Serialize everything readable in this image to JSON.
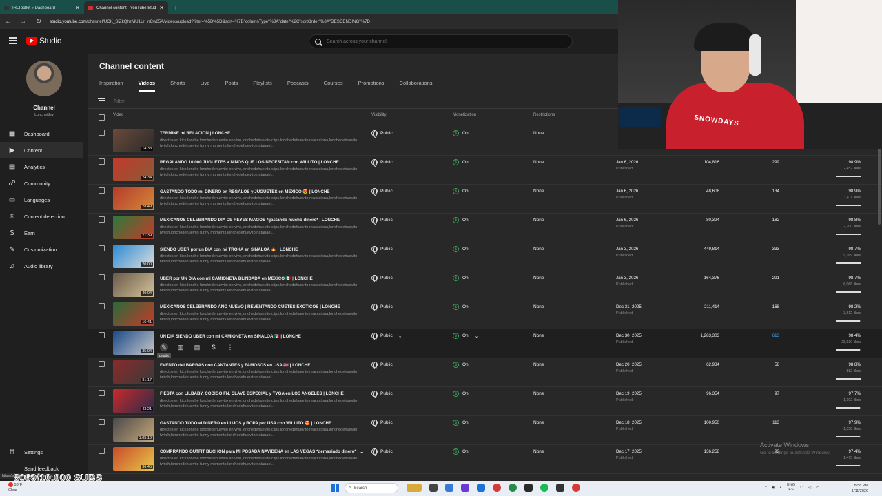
{
  "browser": {
    "tabs": [
      {
        "label": "IRLToolkit » Dashboard",
        "active": false
      },
      {
        "label": "Channel content - YouTube Studio",
        "active": true
      }
    ],
    "url_host": "studio.youtube.com",
    "url_path": "/channel/UCK_SlZkQhzMU1LrHnCw85A/videos/upload?filter=%5B%5D&sort=%7B\"columnType\"%3A\"date\"%2C\"sortOrder\"%3A\"DESCENDING\"%7D"
  },
  "header": {
    "logo_text": "Studio",
    "search_placeholder": "Search across your channel"
  },
  "sidebar": {
    "channel_label": "Channel",
    "channel_handle": "Loncheitley",
    "items": [
      {
        "label": "Dashboard",
        "icon": "dashboard-icon",
        "glyph": "▦"
      },
      {
        "label": "Content",
        "icon": "content-icon",
        "glyph": "▶",
        "active": true
      },
      {
        "label": "Analytics",
        "icon": "analytics-icon",
        "glyph": "▤"
      },
      {
        "label": "Community",
        "icon": "community-icon",
        "glyph": "☍"
      },
      {
        "label": "Languages",
        "icon": "languages-icon",
        "glyph": "▭"
      },
      {
        "label": "Content detection",
        "icon": "copyright-icon",
        "glyph": "©"
      },
      {
        "label": "Earn",
        "icon": "earn-icon",
        "glyph": "$"
      },
      {
        "label": "Customization",
        "icon": "customization-icon",
        "glyph": "✎"
      },
      {
        "label": "Audio library",
        "icon": "audio-library-icon",
        "glyph": "♫"
      }
    ],
    "settings_label": "Settings",
    "feedback_label": "Send feedback"
  },
  "main": {
    "title": "Channel content",
    "tabs": [
      "Inspiration",
      "Videos",
      "Shorts",
      "Live",
      "Posts",
      "Playlists",
      "Podcasts",
      "Courses",
      "Promotions",
      "Collaborations"
    ],
    "active_tab": "Videos",
    "filter_placeholder": "Filter",
    "columns": {
      "video": "Video",
      "visibility": "Visibility",
      "monetization": "Monetization",
      "restrictions": "Restrictions"
    }
  },
  "rows": [
    {
      "title": "TERMINE mi RELACION | LONCHE",
      "desc": "directos en kick:lonche lonchedehuevito en vivo,lonchedehuevito clips,lonchedehuevito reaccciona,lonchedehuevito twitch,lonchedehuevito funny moments,lonchedehuevito natanael...",
      "duration": "14:38",
      "visibility": "Public",
      "monetization": "On",
      "restrictions": "None",
      "date": "",
      "date_sub": "",
      "views": "",
      "comments": "",
      "pct": "",
      "likes": "",
      "ratio": 0,
      "thumb": [
        "#6a4a3a",
        "#2a2a2a"
      ]
    },
    {
      "title": "REGALANDO 10.000 JUGUETES a NIÑOS QUE LOS NECESITAN con WILLITO | LONCHE",
      "desc": "directos en kick:lonche lonchedehuevito en vivo,lonchedehuevito clips,lonchedehuevito reaccciona,lonchedehuevito twitch,lonchedehuevito funny moments,lonchedehuevito natanael...",
      "duration": "24:34",
      "visibility": "Public",
      "monetization": "On",
      "restrictions": "None",
      "date": "Jan 6, 2026",
      "date_sub": "Published",
      "views": "104,816",
      "comments": "299",
      "pct": "98.9%",
      "likes": "2,452 likes",
      "ratio": 0.989,
      "thumb": [
        "#c23a2a",
        "#8a5a3a"
      ]
    },
    {
      "title": "GASTANDO TODO mi DINERO en REGALOS y JUGUETES en MEXICO 😍 | LONCHE",
      "desc": "directos en kick:lonche lonchedehuevito en vivo,lonchedehuevito clips,lonchedehuevito reaccciona,lonchedehuevito twitch,lonchedehuevito funny moments,lonchedehuevito natanael...",
      "duration": "28:49",
      "visibility": "Public",
      "monetization": "On",
      "restrictions": "None",
      "date": "Jan 6, 2026",
      "date_sub": "Published",
      "views": "48,608",
      "comments": "134",
      "pct": "98.9%",
      "likes": "1,411 likes",
      "ratio": 0.989,
      "thumb": [
        "#b53a2a",
        "#d48a3a"
      ]
    },
    {
      "title": "MEXICANOS CELEBRANDO DIA DE REYES MAGOS *gastando mucho dinero* | LONCHE",
      "desc": "directos en kick:lonche lonchedehuevito en vivo,lonchedehuevito clips,lonchedehuevito reaccciona,lonchedehuevito twitch,lonchedehuevito funny moments,lonchedehuevito natanael...",
      "duration": "21:39",
      "visibility": "Public",
      "monetization": "On",
      "restrictions": "None",
      "date": "Jan 6, 2026",
      "date_sub": "Published",
      "views": "80,324",
      "comments": "182",
      "pct": "98.8%",
      "likes": "2,200 likes",
      "ratio": 0.988,
      "thumb": [
        "#2a7a3a",
        "#c83a2a"
      ]
    },
    {
      "title": "SIENDO UBER por un DIA con mi TROKA en SINALOA 🔥 | LONCHE",
      "desc": "directos en kick:lonche lonchedehuevito en vivo,lonchedehuevito clips,lonchedehuevito reaccciona,lonchedehuevito twitch,lonchedehuevito funny moments,lonchedehuevito natanael...",
      "duration": "20:00",
      "visibility": "Public",
      "monetization": "On",
      "restrictions": "None",
      "date": "Jan 3, 2026",
      "date_sub": "Published",
      "views": "449,814",
      "comments": "333",
      "pct": "98.7%",
      "likes": "9,169 likes",
      "ratio": 0.987,
      "thumb": [
        "#2a8ad4",
        "#ddd"
      ]
    },
    {
      "title": "UBER por UN DÍA con mi CAMIONETA BLINDADA en MEXICO 🇲🇽 | LONCHE",
      "desc": "directos en kick:lonche lonchedehuevito en vivo,lonchedehuevito clips,lonchedehuevito reaccciona,lonchedehuevito twitch,lonchedehuevito funny moments,lonchedehuevito natanael...",
      "duration": "40:04",
      "visibility": "Public",
      "monetization": "On",
      "restrictions": "None",
      "date": "Jan 3, 2026",
      "date_sub": "Published",
      "views": "164,376",
      "comments": "291",
      "pct": "98.7%",
      "likes": "6,068 likes",
      "ratio": 0.987,
      "thumb": [
        "#6a5a4a",
        "#d4c49a"
      ]
    },
    {
      "title": "MEXICANOS CELEBRANDO AÑO NUEVO | REVENTANDO CUETES EXOTICOS | LONCHE",
      "desc": "directos en kick:lonche lonchedehuevito en vivo,lonchedehuevito clips,lonchedehuevito reaccciona,lonchedehuevito twitch,lonchedehuevito funny moments,lonchedehuevito natanael...",
      "duration": "16:41",
      "visibility": "Public",
      "monetization": "On",
      "restrictions": "None",
      "date": "Dec 31, 2025",
      "date_sub": "Published",
      "views": "211,414",
      "comments": "168",
      "pct": "98.2%",
      "likes": "3,612 likes",
      "ratio": 0.982,
      "thumb": [
        "#2a6a3a",
        "#c83a2a"
      ]
    },
    {
      "title": "UN DIA SIENDO UBER con mi CAMIONETA en SINALOA 🇲🇽 | LONCHE",
      "desc": "",
      "duration": "35:04",
      "visibility": "Public",
      "monetization": "On",
      "restrictions": "None",
      "date": "Dec 30, 2025",
      "date_sub": "Published",
      "views": "1,283,303",
      "comments": "613",
      "pct": "98.4%",
      "likes": "25,930 likes",
      "ratio": 0.984,
      "thumb": [
        "#1a4a8a",
        "#c8c8c8"
      ],
      "hover": true
    },
    {
      "title": "EVENTO del BARBAS con CANTANTES y FAMOSOS en USA 🇺🇸 | LONCHE",
      "desc": "directos en kick:lonche lonchedehuevito en vivo,lonchedehuevito clips,lonchedehuevito reaccciona,lonchedehuevito twitch,lonchedehuevito funny moments,lonchedehuevito natanael...",
      "duration": "31:17",
      "visibility": "Public",
      "monetization": "On",
      "restrictions": "None",
      "date": "Dec 20, 2025",
      "date_sub": "Published",
      "views": "62,934",
      "comments": "58",
      "pct": "98.8%",
      "likes": "882 likes",
      "ratio": 0.988,
      "thumb": [
        "#8a2a2a",
        "#3a3a3a"
      ]
    },
    {
      "title": "FIESTA con LILBABY, CODIGO FN, CLAVE ESPECIAL y TYGA en LOS ANGELES | LONCHE",
      "desc": "directos en kick:lonche lonchedehuevito en vivo,lonchedehuevito clips,lonchedehuevito reaccciona,lonchedehuevito twitch,lonchedehuevito funny moments,lonchedehuevito natanael...",
      "duration": "43:21",
      "visibility": "Public",
      "monetization": "On",
      "restrictions": "None",
      "date": "Dec 19, 2025",
      "date_sub": "Published",
      "views": "96,354",
      "comments": "97",
      "pct": "97.7%",
      "likes": "1,102 likes",
      "ratio": 0.977,
      "thumb": [
        "#c82a2a",
        "#2a2a4a"
      ]
    },
    {
      "title": "GASTANDO TODO el DINERO en LUJOS y ROPA por USA con WILLITO 😍 | LONCHE",
      "desc": "directos en kick:lonche lonchedehuevito en vivo,lonchedehuevito clips,lonchedehuevito reaccciona,lonchedehuevito twitch,lonchedehuevito funny moments,lonchedehuevito natanael...",
      "duration": "1:05:18",
      "visibility": "Public",
      "monetization": "On",
      "restrictions": "None",
      "date": "Dec 18, 2025",
      "date_sub": "Published",
      "views": "100,950",
      "comments": "113",
      "pct": "97.9%",
      "likes": "1,358 likes",
      "ratio": 0.979,
      "thumb": [
        "#4a4a4a",
        "#c8a87a"
      ]
    },
    {
      "title": "COMPRANDO OUTFIT BUCHÓN para MI POSADA NAVIDEÑA en LAS VEGAS *demasiado dinero* | ...",
      "desc": "directos en kick:lonche lonchedehuevito en vivo,lonchedehuevito clips,lonchedehuevito reaccciona,lonchedehuevito twitch,lonchedehuevito funny moments,lonchedehuevito natanael...",
      "duration": "36:45",
      "visibility": "Public",
      "monetization": "On",
      "restrictions": "None",
      "date": "Dec 17, 2025",
      "date_sub": "Published",
      "views": "136,258",
      "comments": "92",
      "pct": "97.4%",
      "likes": "1,475 likes",
      "ratio": 0.974,
      "thumb": [
        "#c84a2a",
        "#e8c84a"
      ]
    }
  ],
  "hover_tooltip": "Details",
  "overlay": {
    "subs": "8069/10.000 SUBS",
    "status_url": "https://studio.youtube.com/video/...",
    "watermark_title": "Activate Windows",
    "watermark_sub": "Go to Settings to activate Windows.",
    "cam_shirt_text": "SNOWDAYS"
  },
  "taskbar": {
    "weather_temp": "53°F",
    "weather_desc": "Clear",
    "search_label": "Search",
    "lang_top": "ENG",
    "lang_bottom": "ES",
    "time": "8:58 PM",
    "date": "1/11/2026"
  },
  "colors": {
    "accent_green": "#3ea55a",
    "link_blue": "#3ea6ff",
    "youtube_red": "#ff0000"
  }
}
